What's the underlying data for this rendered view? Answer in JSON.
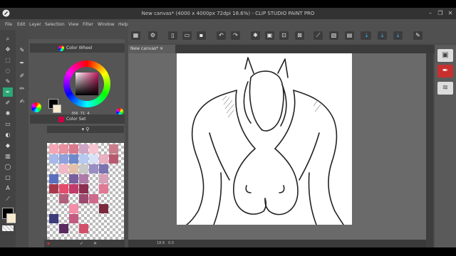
{
  "window": {
    "title": "New canvas* (4000 x 4000px 72dpi 18.6%) - CLIP STUDIO PAINT PRO",
    "controls": [
      "–",
      "❐",
      "✕"
    ]
  },
  "menu": [
    "File",
    "Edit",
    "Layer",
    "Selection",
    "View",
    "Filter",
    "Window",
    "Help"
  ],
  "document_tab": {
    "label": "New canvas*"
  },
  "panels": {
    "color_wheel": {
      "title": "Color Wheel",
      "values": [
        "356",
        "71",
        "4"
      ]
    },
    "color_set": {
      "title": "Color Set"
    }
  },
  "status": {
    "zoom": "18.6",
    "extra": "0.0"
  },
  "colors": {
    "accent": "#3ab4ff",
    "swatches": [
      "#f4a6b4",
      "#e88fa0",
      "#d97a8c",
      "#cfa4c7",
      "#f7c4d0",
      "#ffffff",
      "#c97d8a",
      "#a8b8e8",
      "#8fa0da",
      "#6f88cc",
      "#b6c9ee",
      "#d7e1f7",
      "#e8b0c0",
      "#b85a6e",
      "#ffffff",
      "#f2b8c8",
      "#e4c0a8",
      "#c8c8c8",
      "#9a8fc2",
      "#7c72b0",
      "#ffffff",
      "#5a6fbf",
      "#ffffff",
      "#7a5f9e",
      "#b07aa8",
      "#ffffff",
      "#d6a0b8",
      "#ffffff",
      "#a63a4c",
      "#e54b6c",
      "#c23a68",
      "#8c2e50",
      "#ffffff",
      "#e07a94",
      "#ffffff",
      "#ffffff",
      "#b0607a",
      "#ffffff",
      "#9c4a70",
      "#d06a8c",
      "#ffffff",
      "#ffffff",
      "#ffffff",
      "#ffffff",
      "#f28ea8",
      "#ffffff",
      "#ffffff",
      "#7a2a3c",
      "#ffffff",
      "#3c3c7a",
      "#ffffff",
      "#c45a80",
      "#ffffff",
      "#ffffff",
      "#ffffff",
      "#ffffff",
      "#ffffff",
      "#5a2a60",
      "#ffffff",
      "#d2506c",
      "#ffffff",
      "#ffffff",
      "#ffffff"
    ]
  }
}
